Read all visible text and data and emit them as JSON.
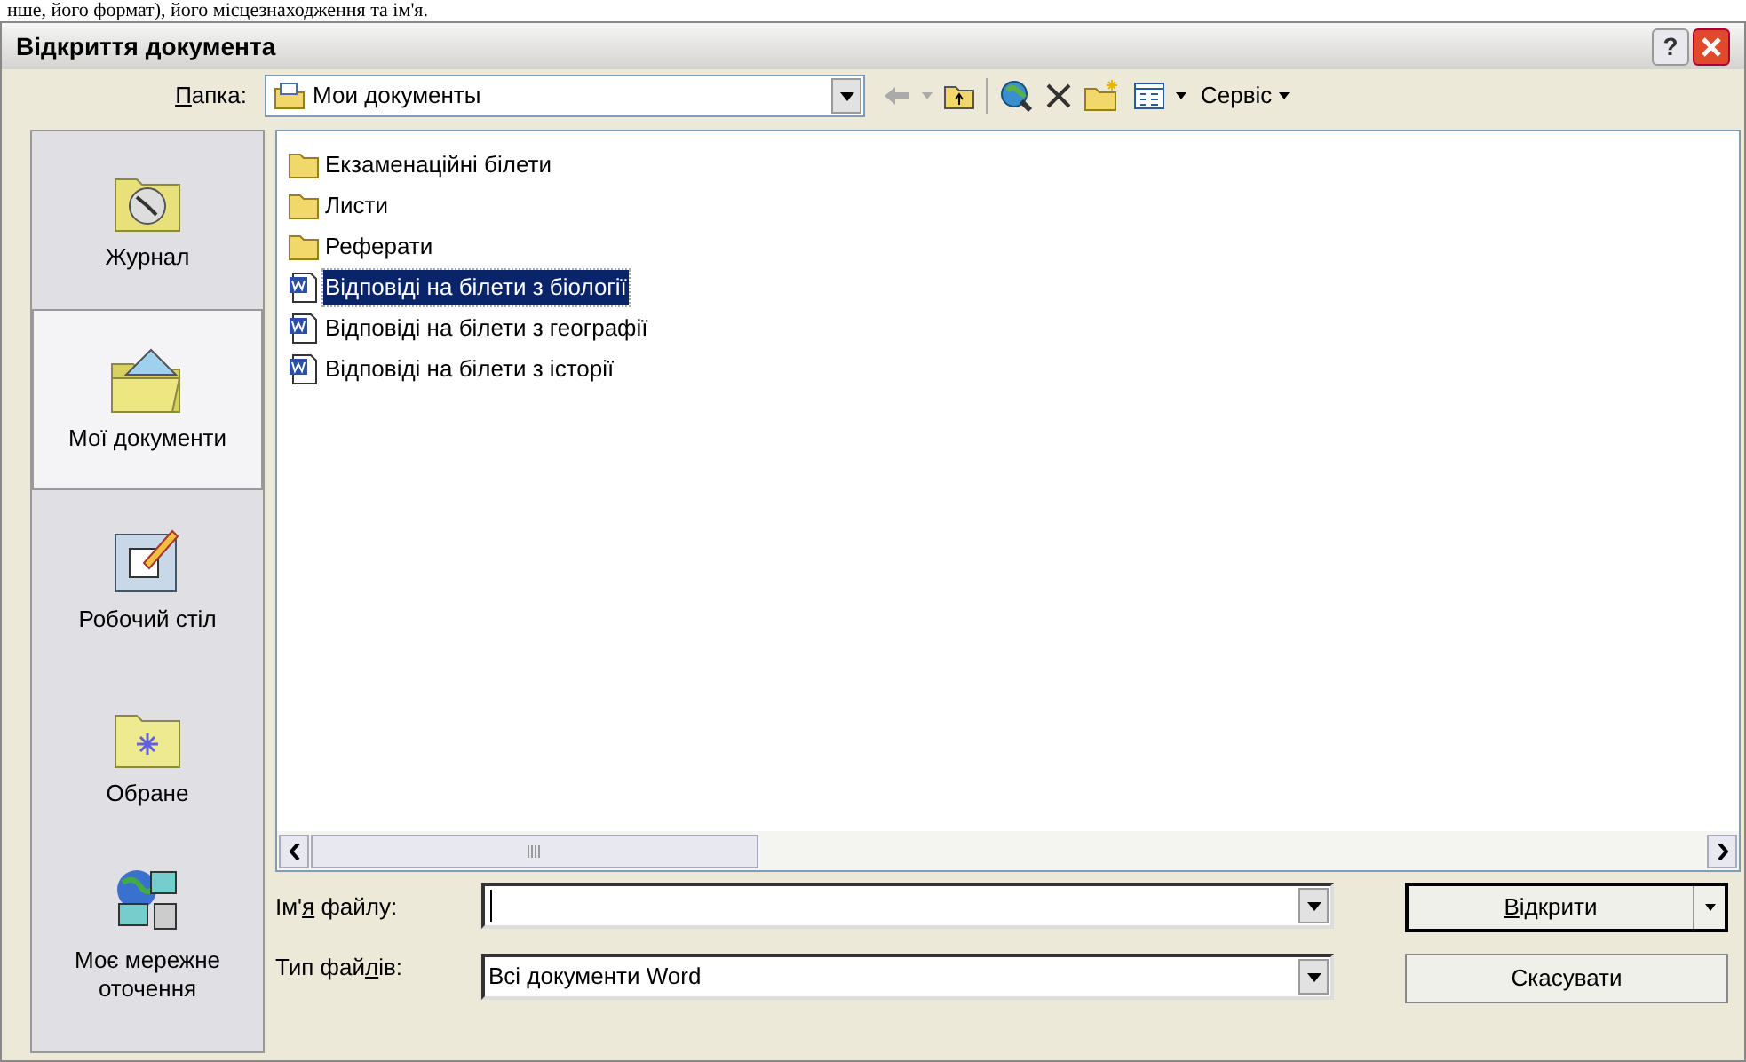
{
  "document_text": "нше, його формат), його місцезнаходження та ім'я.",
  "window": {
    "title": "Відкриття документа",
    "help_button": "?"
  },
  "toolbar": {
    "folder_label": {
      "key": "П",
      "post": "апка:"
    },
    "folder_value": "Мои документы",
    "back_disabled": true,
    "tools_menu": "Сервіс"
  },
  "places": [
    {
      "kind": "history",
      "label": "Журнал",
      "selected": false
    },
    {
      "kind": "documents",
      "label": "Мої документи",
      "selected": true
    },
    {
      "kind": "desktop",
      "label": "Робочий стіл",
      "selected": false
    },
    {
      "kind": "favorites",
      "label": "Обране",
      "selected": false
    },
    {
      "kind": "network",
      "label": "Моє мережне оточення",
      "selected": false
    }
  ],
  "files": [
    {
      "kind": "folder",
      "name": "Екзаменаційні білети",
      "selected": false
    },
    {
      "kind": "folder",
      "name": "Листи",
      "selected": false
    },
    {
      "kind": "folder",
      "name": "Реферати",
      "selected": false
    },
    {
      "kind": "word",
      "name": "Відповіді на білети з біології",
      "selected": true
    },
    {
      "kind": "word",
      "name": "Відповіді на білети з географії",
      "selected": false
    },
    {
      "kind": "word",
      "name": "Відповіді на білети з історії",
      "selected": false
    }
  ],
  "file_name": {
    "label": {
      "pre": "Ім'",
      "key": "я",
      "post": " файлу:"
    },
    "focused": true
  },
  "file_type": {
    "label": {
      "pre": "Тип фай",
      "key": "л",
      "post": "ів:"
    },
    "value": "Всі документи Word"
  },
  "buttons": [
    {
      "kind": "open",
      "label": {
        "key": "В",
        "post": "ідкрити"
      }
    },
    {
      "kind": "cancel",
      "label": {
        "post": "Скасувати"
      }
    }
  ]
}
